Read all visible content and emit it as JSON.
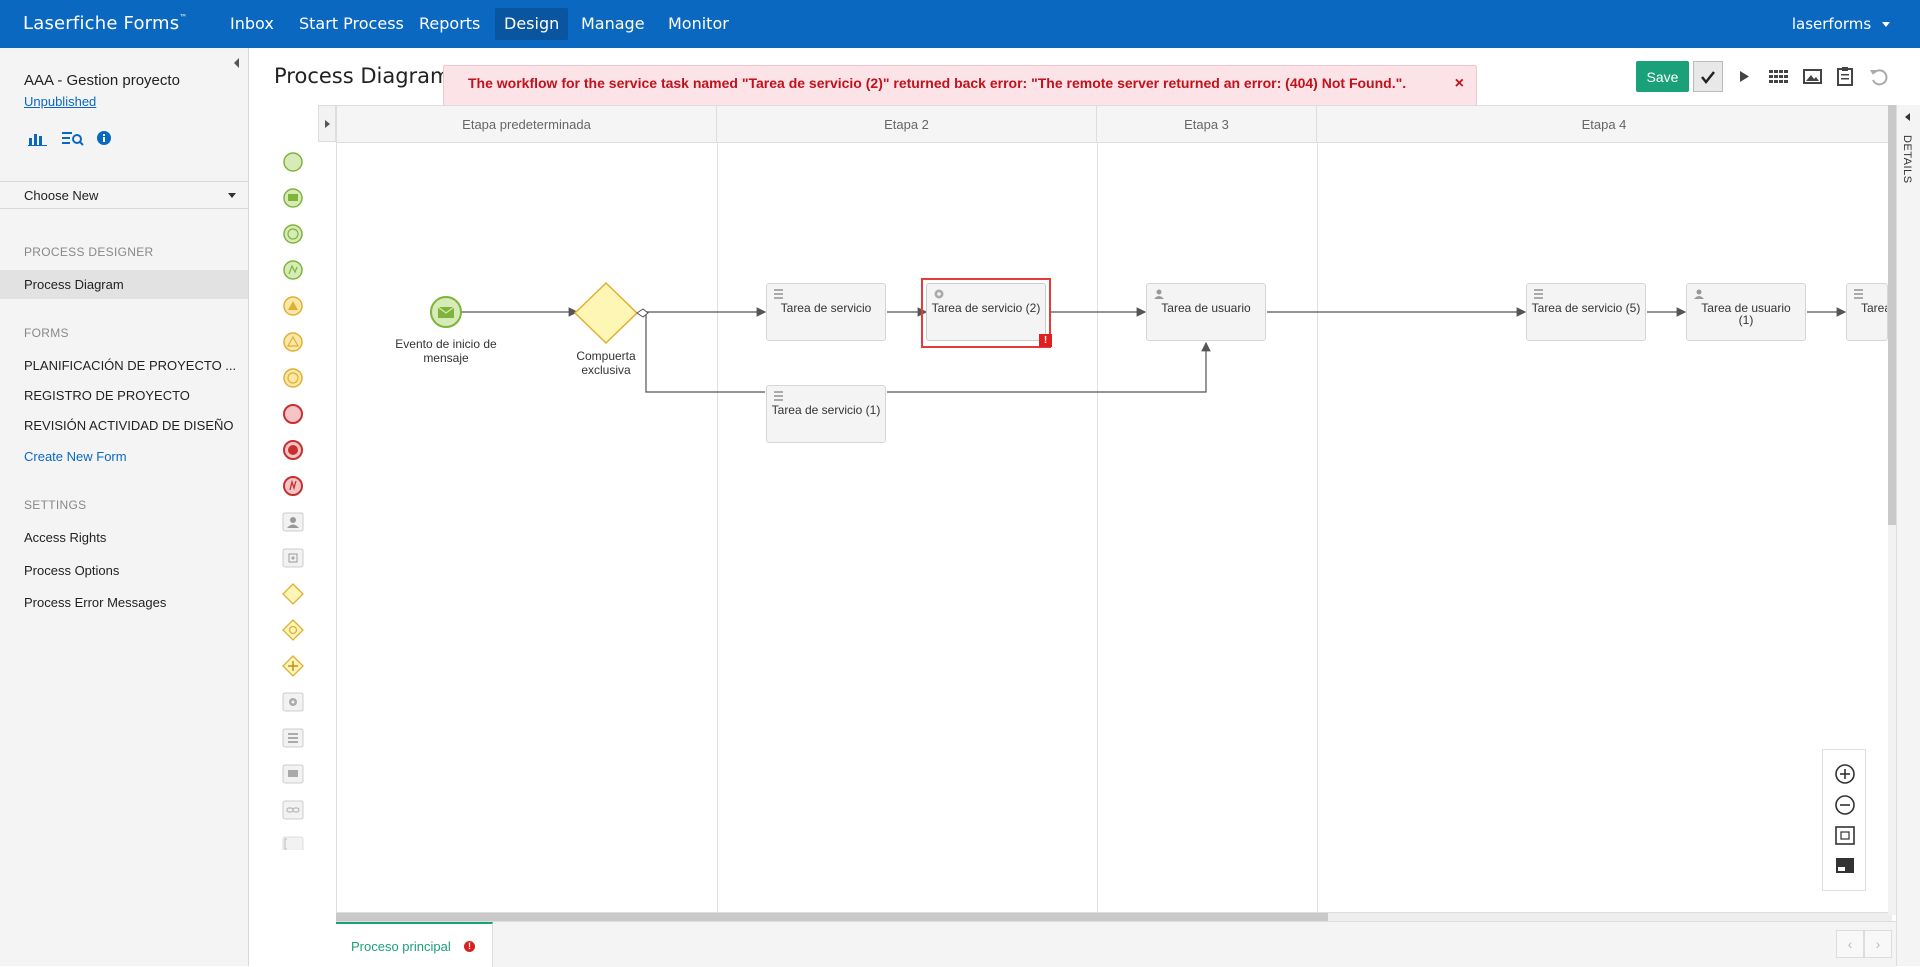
{
  "app": {
    "brand": "Laserfiche Forms",
    "trademark": "™",
    "nav": [
      "Inbox",
      "Start Process",
      "Reports",
      "Design",
      "Manage",
      "Monitor"
    ],
    "active_nav": "Design",
    "user": "laserforms"
  },
  "sidebar": {
    "process_name": "AAA - Gestion proyecto",
    "status": "Unpublished",
    "choose_new": "Choose New",
    "section_designer": "PROCESS DESIGNER",
    "designer_items": [
      "Process Diagram"
    ],
    "section_forms": "FORMS",
    "forms": [
      "PLANIFICACIÓN DE PROYECTO ...",
      "REGISTRO DE PROYECTO",
      "REVISIÓN ACTIVIDAD DE DISEÑO"
    ],
    "create_form": "Create New Form",
    "section_settings": "SETTINGS",
    "settings_items": [
      "Access Rights",
      "Process Options",
      "Process Error Messages"
    ]
  },
  "page": {
    "title": "Process Diagram",
    "error_message": "The workflow for the service task named \"Tarea de servicio (2)\" returned back error: \"The remote server returned an error: (404) Not Found.\".",
    "save_label": "Save",
    "details_label": "DETAILS"
  },
  "lanes": [
    "Etapa predeterminada",
    "Etapa 2",
    "Etapa 3",
    "Etapa 4"
  ],
  "diagram": {
    "start_event": "Evento de inicio de mensaje",
    "gateway": "Compuerta exclusiva",
    "tasks": [
      "Tarea de servicio",
      "Tarea de servicio (2)",
      "Tarea de usuario",
      "Tarea de servicio (5)",
      "Tarea de usuario (1)",
      "Tarea",
      "Tarea de servicio (1)"
    ]
  },
  "tabs": {
    "main": "Proceso principal",
    "warn": "!"
  },
  "colors": {
    "topbar": "#0b68c0",
    "save": "#1aa179",
    "error_text": "#c1121c",
    "error_bg": "#fbe3e8"
  }
}
